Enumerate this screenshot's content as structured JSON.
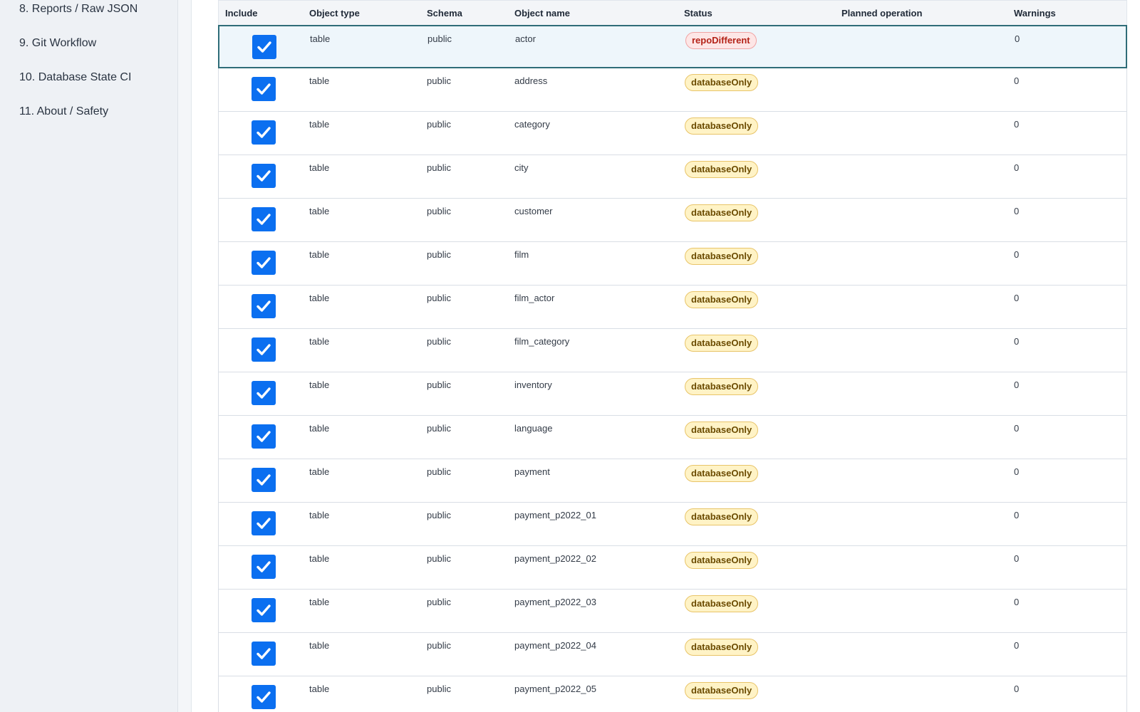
{
  "sidebar": {
    "items": [
      {
        "label": "8. Reports / Raw JSON"
      },
      {
        "label": "9. Git Workflow"
      },
      {
        "label": "10. Database State CI"
      },
      {
        "label": "11. About / Safety"
      }
    ]
  },
  "table": {
    "headers": [
      "Include",
      "Object type",
      "Schema",
      "Object name",
      "Status",
      "Planned operation",
      "Warnings"
    ],
    "rows": [
      {
        "included": true,
        "object_type": "table",
        "schema": "public",
        "object_name": "actor",
        "status": "repoDifferent",
        "planned_operation": "",
        "warnings": "0",
        "selected": true
      },
      {
        "included": true,
        "object_type": "table",
        "schema": "public",
        "object_name": "address",
        "status": "databaseOnly",
        "planned_operation": "",
        "warnings": "0"
      },
      {
        "included": true,
        "object_type": "table",
        "schema": "public",
        "object_name": "category",
        "status": "databaseOnly",
        "planned_operation": "",
        "warnings": "0"
      },
      {
        "included": true,
        "object_type": "table",
        "schema": "public",
        "object_name": "city",
        "status": "databaseOnly",
        "planned_operation": "",
        "warnings": "0"
      },
      {
        "included": true,
        "object_type": "table",
        "schema": "public",
        "object_name": "customer",
        "status": "databaseOnly",
        "planned_operation": "",
        "warnings": "0"
      },
      {
        "included": true,
        "object_type": "table",
        "schema": "public",
        "object_name": "film",
        "status": "databaseOnly",
        "planned_operation": "",
        "warnings": "0"
      },
      {
        "included": true,
        "object_type": "table",
        "schema": "public",
        "object_name": "film_actor",
        "status": "databaseOnly",
        "planned_operation": "",
        "warnings": "0"
      },
      {
        "included": true,
        "object_type": "table",
        "schema": "public",
        "object_name": "film_category",
        "status": "databaseOnly",
        "planned_operation": "",
        "warnings": "0"
      },
      {
        "included": true,
        "object_type": "table",
        "schema": "public",
        "object_name": "inventory",
        "status": "databaseOnly",
        "planned_operation": "",
        "warnings": "0"
      },
      {
        "included": true,
        "object_type": "table",
        "schema": "public",
        "object_name": "language",
        "status": "databaseOnly",
        "planned_operation": "",
        "warnings": "0"
      },
      {
        "included": true,
        "object_type": "table",
        "schema": "public",
        "object_name": "payment",
        "status": "databaseOnly",
        "planned_operation": "",
        "warnings": "0"
      },
      {
        "included": true,
        "object_type": "table",
        "schema": "public",
        "object_name": "payment_p2022_01",
        "status": "databaseOnly",
        "planned_operation": "",
        "warnings": "0"
      },
      {
        "included": true,
        "object_type": "table",
        "schema": "public",
        "object_name": "payment_p2022_02",
        "status": "databaseOnly",
        "planned_operation": "",
        "warnings": "0"
      },
      {
        "included": true,
        "object_type": "table",
        "schema": "public",
        "object_name": "payment_p2022_03",
        "status": "databaseOnly",
        "planned_operation": "",
        "warnings": "0"
      },
      {
        "included": true,
        "object_type": "table",
        "schema": "public",
        "object_name": "payment_p2022_04",
        "status": "databaseOnly",
        "planned_operation": "",
        "warnings": "0"
      },
      {
        "included": true,
        "object_type": "table",
        "schema": "public",
        "object_name": "payment_p2022_05",
        "status": "databaseOnly",
        "planned_operation": "",
        "warnings": "0"
      }
    ]
  },
  "colors": {
    "checkbox": "#0b6ff0",
    "selected_border": "#2f6d78",
    "databaseOnly_bg": "#fff3c6",
    "repoDifferent_bg": "#fde6e6",
    "repoDifferent_text": "#b42318"
  },
  "icons": {
    "checkbox": "check-icon"
  }
}
